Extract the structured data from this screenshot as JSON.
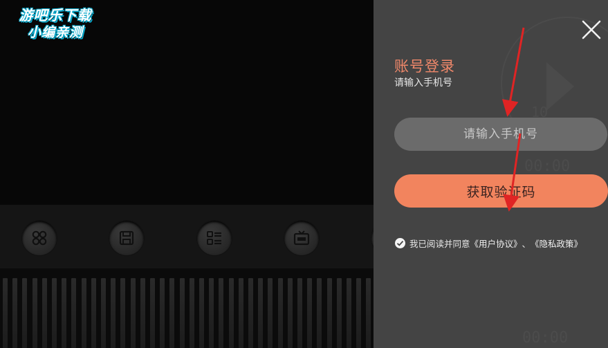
{
  "watermark": {
    "line1": "游吧乐下载",
    "line2": "小编亲测"
  },
  "login": {
    "title": "账号登录",
    "subtitle": "请输入手机号",
    "phone_placeholder": "请输入手机号",
    "get_code_label": "获取验证码",
    "agree_text": "我已阅读并同意",
    "user_agreement": "《用户协议》",
    "separator": "、",
    "privacy_policy": "《隐私政策》"
  },
  "background_readouts": {
    "level_top": "10",
    "time_mid": "00:00",
    "time_bottom": "00:00"
  },
  "toolbar": {
    "icons": [
      "grid-icon",
      "save-icon",
      "list-icon",
      "vip-tv-icon"
    ]
  },
  "colors": {
    "accent": "#f2845e",
    "title": "#f0886a",
    "panel_bg": "#444444",
    "input_bg": "#6b6b6b",
    "annotation": "#e02424",
    "watermark_outline": "#0aa7c9"
  }
}
